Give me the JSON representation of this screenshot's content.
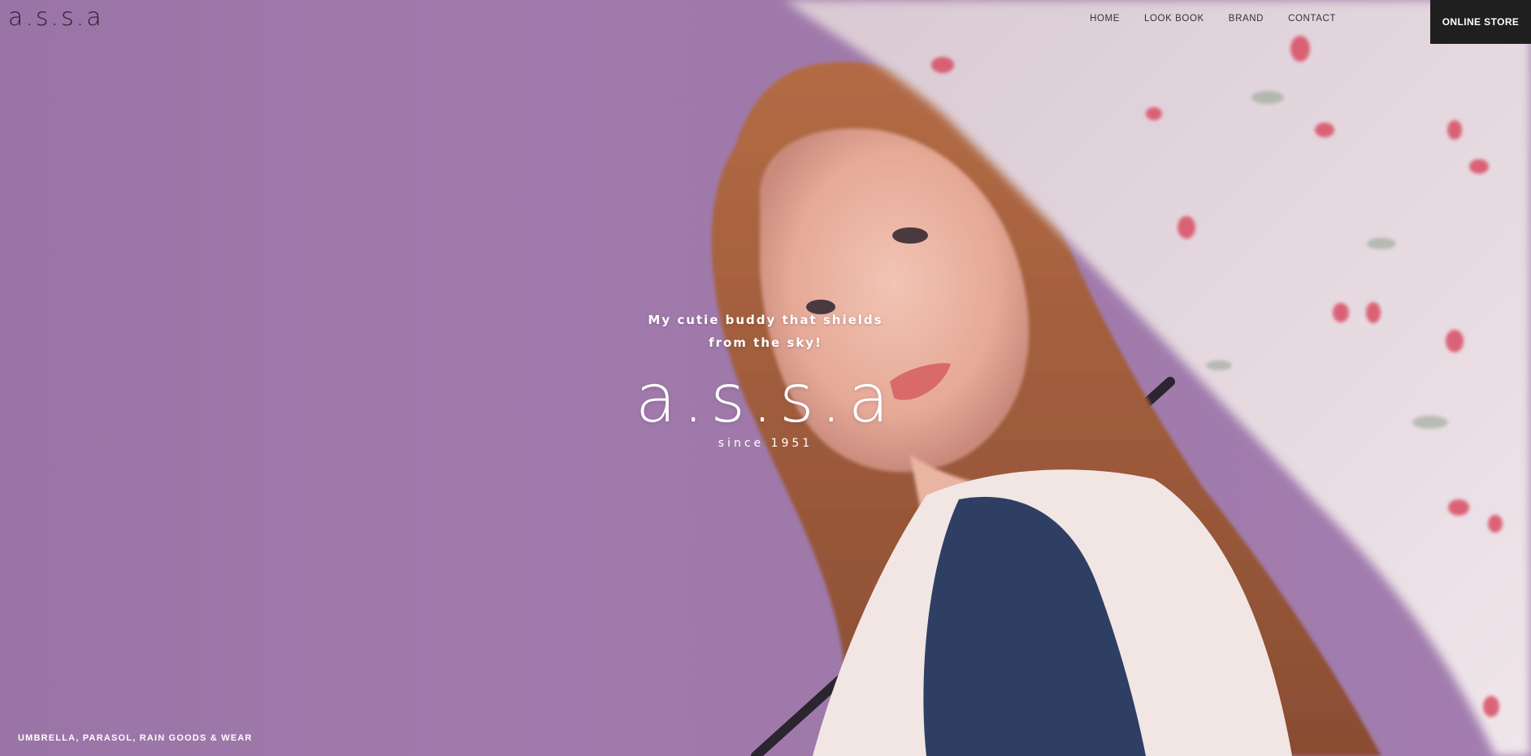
{
  "header": {
    "logo": "a.s.s.a",
    "nav": [
      {
        "label": "HOME"
      },
      {
        "label": "LOOK BOOK"
      },
      {
        "label": "BRAND"
      },
      {
        "label": "CONTACT"
      }
    ],
    "online_store_label": "ONLINE STORE"
  },
  "hero": {
    "tagline_line1": "My cutie buddy that shields",
    "tagline_line2": "from the sky!",
    "brand": "a.s.s.a",
    "since": "since 1951",
    "caption": "UMBRELLA, PARASOL, RAIN GOODS & WEAR"
  },
  "colors": {
    "background": "#a17aac",
    "store_button": "#1f1f1f",
    "text_light": "#ffffff",
    "text_dark": "#2a2230"
  }
}
